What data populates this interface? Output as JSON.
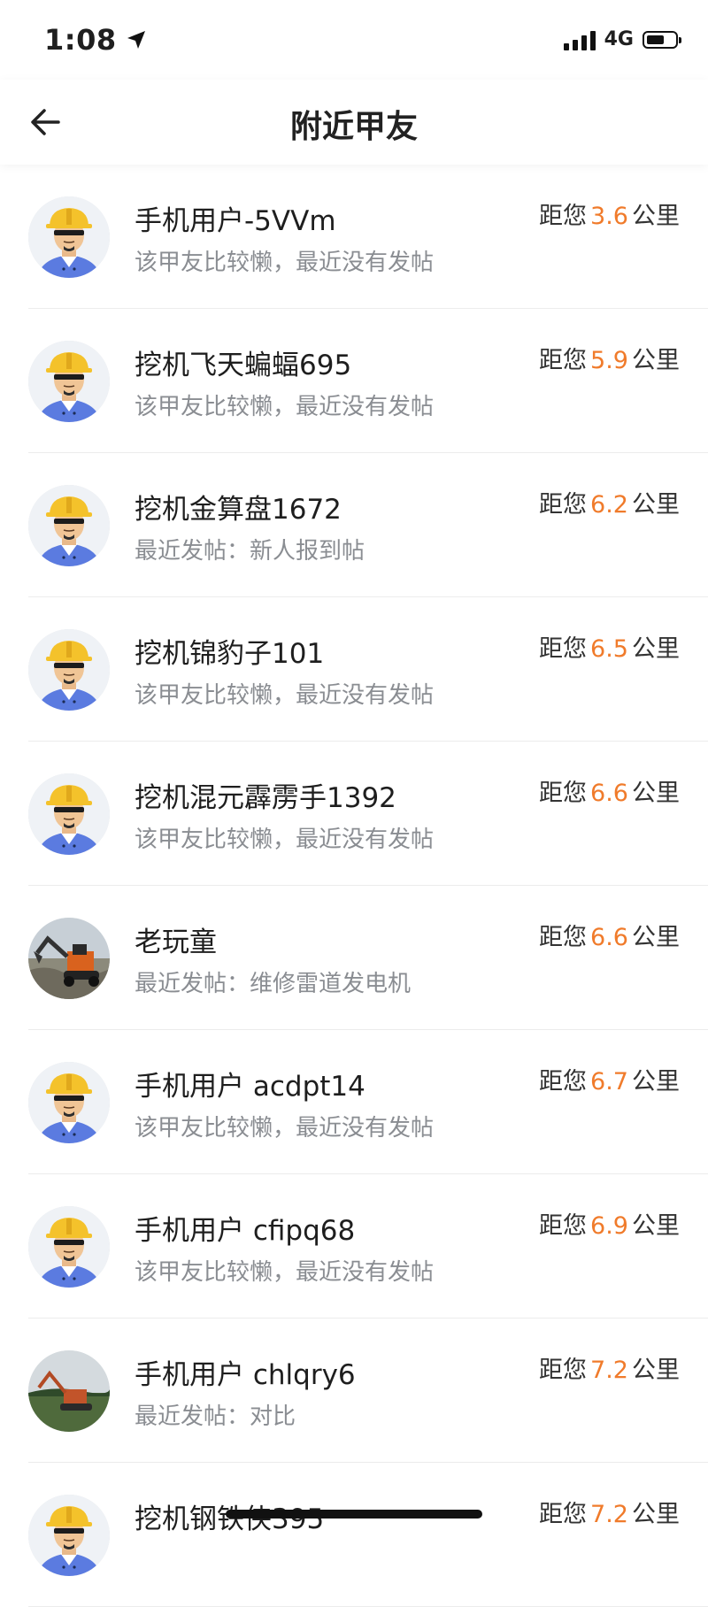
{
  "status_bar": {
    "time": "1:08",
    "network": "4G"
  },
  "header": {
    "title": "附近甲友"
  },
  "distance_prefix": "距您",
  "distance_unit": "公里",
  "users": [
    {
      "name": "手机用户-5VVm",
      "status": "该甲友比较懒，最近没有发帖",
      "distance": "3.6",
      "avatar": "worker-avatar"
    },
    {
      "name": "挖机飞天蝙蝠695",
      "status": "该甲友比较懒，最近没有发帖",
      "distance": "5.9",
      "avatar": "worker-avatar"
    },
    {
      "name": "挖机金算盘1672",
      "status": "最近发帖：新人报到帖",
      "distance": "6.2",
      "avatar": "worker-avatar"
    },
    {
      "name": "挖机锦豹子101",
      "status": "该甲友比较懒，最近没有发帖",
      "distance": "6.5",
      "avatar": "worker-avatar"
    },
    {
      "name": "挖机混元霹雳手1392",
      "status": "该甲友比较懒，最近没有发帖",
      "distance": "6.6",
      "avatar": "worker-avatar"
    },
    {
      "name": "老玩童",
      "status": "最近发帖：维修雷道发电机",
      "distance": "6.6",
      "avatar": "excavator-photo"
    },
    {
      "name": "手机用户 acdpt14",
      "status": "该甲友比较懒，最近没有发帖",
      "distance": "6.7",
      "avatar": "worker-avatar"
    },
    {
      "name": "手机用户 cfipq68",
      "status": "该甲友比较懒，最近没有发帖",
      "distance": "6.9",
      "avatar": "worker-avatar"
    },
    {
      "name": "手机用户 chlqry6",
      "status": "最近发帖：对比",
      "distance": "7.2",
      "avatar": "excavator-photo-2"
    },
    {
      "name": "挖机钢铁侠395",
      "status": "",
      "distance": "7.2",
      "avatar": "worker-avatar"
    }
  ],
  "colors": {
    "accent": "#f07b2b",
    "secondary_text": "#8a8d92",
    "helmet": "#f4c22b",
    "shirt": "#5b7be0"
  }
}
